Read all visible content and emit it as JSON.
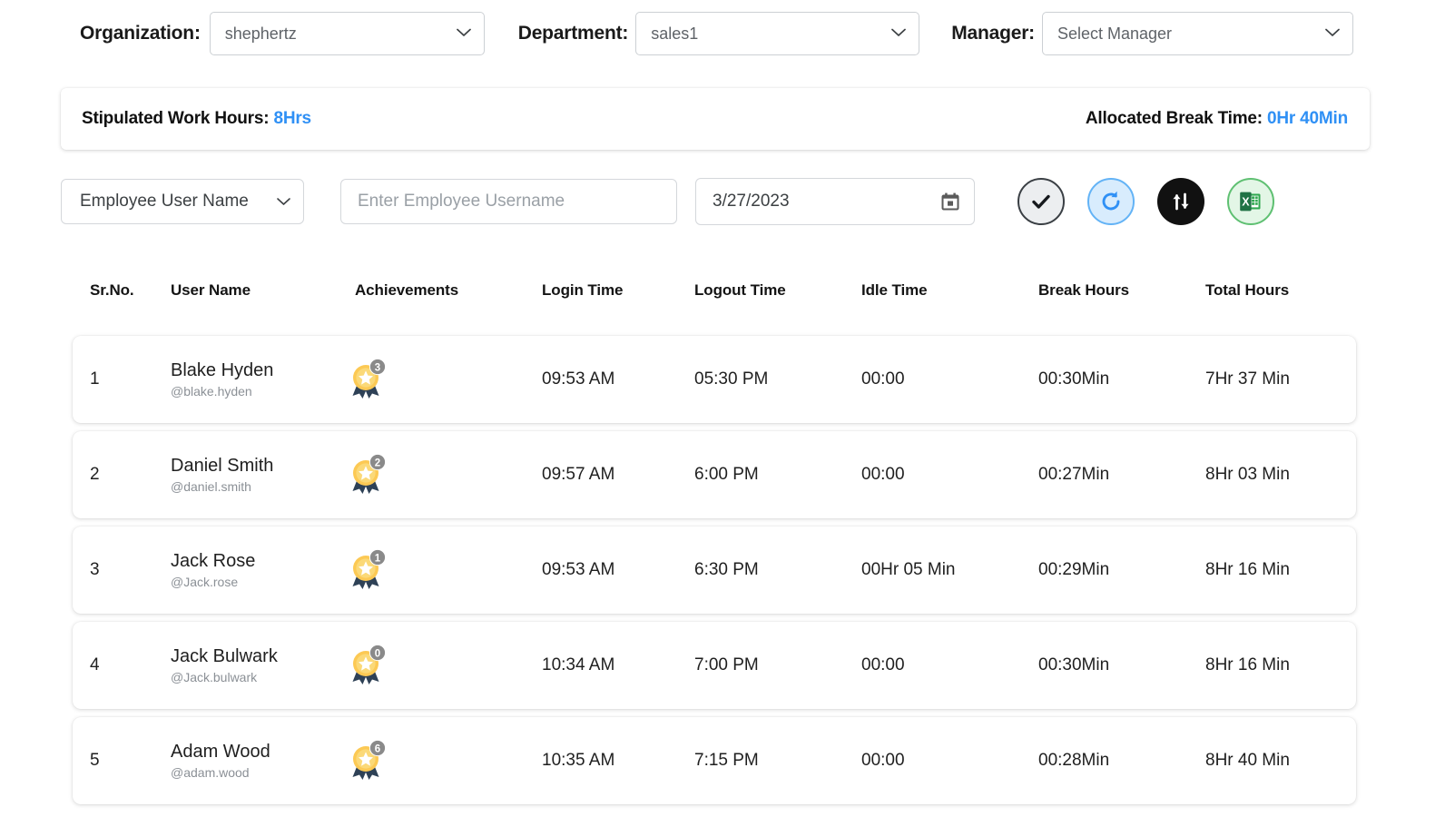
{
  "filters": {
    "organization": {
      "label": "Organization:",
      "value": "shephertz"
    },
    "department": {
      "label": "Department:",
      "value": "sales1"
    },
    "manager": {
      "label": "Manager:",
      "value": "Select Manager"
    }
  },
  "info": {
    "stipulated_label": "Stipulated Work Hours: ",
    "stipulated_value": "8Hrs",
    "break_label": "Allocated Break Time: ",
    "break_value": "0Hr 40Min",
    "accent_color": "#2f90f5"
  },
  "controls": {
    "search_by": "Employee User Name",
    "search_placeholder": "Enter Employee Username",
    "search_value": "",
    "date_value": "3/27/2023",
    "buttons": [
      {
        "name": "apply-check-button",
        "icon": "check-icon",
        "color": "#eceef0"
      },
      {
        "name": "refresh-button",
        "icon": "refresh-icon",
        "color": "#d8ecfd"
      },
      {
        "name": "sort-button",
        "icon": "sort-icon",
        "color": "#111111"
      },
      {
        "name": "export-excel-button",
        "icon": "excel-icon",
        "color": "#e3f6e6"
      }
    ]
  },
  "table": {
    "columns": [
      "Sr.No.",
      "User Name",
      "Achievements",
      "Login Time",
      "Logout Time",
      "Idle Time",
      "Break Hours",
      "Total Hours"
    ],
    "rows": [
      {
        "sr": "1",
        "name": "Blake Hyden",
        "handle": "@blake.hyden",
        "achievements": "3",
        "login": "09:53 AM",
        "logout": "05:30 PM",
        "idle": "00:00",
        "break": "00:30Min",
        "total": "7Hr 37 Min"
      },
      {
        "sr": "2",
        "name": "Daniel Smith",
        "handle": "@daniel.smith",
        "achievements": "2",
        "login": "09:57 AM",
        "logout": "6:00 PM",
        "idle": "00:00",
        "break": "00:27Min",
        "total": "8Hr 03 Min"
      },
      {
        "sr": "3",
        "name": "Jack Rose",
        "handle": "@Jack.rose",
        "achievements": "1",
        "login": "09:53 AM",
        "logout": "6:30 PM",
        "idle": "00Hr 05 Min",
        "break": "00:29Min",
        "total": "8Hr 16 Min"
      },
      {
        "sr": "4",
        "name": "Jack Bulwark",
        "handle": "@Jack.bulwark",
        "achievements": "0",
        "login": "10:34 AM",
        "logout": "7:00 PM",
        "idle": "00:00",
        "break": "00:30Min",
        "total": "8Hr 16 Min"
      },
      {
        "sr": "5",
        "name": "Adam Wood",
        "handle": "@adam.wood",
        "achievements": "6",
        "login": "10:35 AM",
        "logout": "7:15 PM",
        "idle": "00:00",
        "break": "00:28Min",
        "total": "8Hr 40 Min"
      }
    ]
  }
}
